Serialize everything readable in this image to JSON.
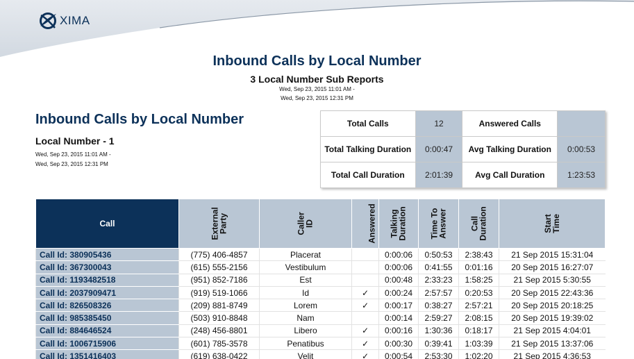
{
  "brand": {
    "name": "XIMA",
    "color": "#0c3159"
  },
  "report": {
    "title": "Inbound Calls by Local Number",
    "subtitle": "3 Local Number Sub Reports",
    "range_line1": "Wed, Sep 23, 2015 11:01 AM -",
    "range_line2": "Wed, Sep 23, 2015 12:31 PM"
  },
  "section": {
    "title": "Inbound Calls by Local Number",
    "name": "Local Number - 1",
    "range_line1": "Wed, Sep 23, 2015 11:01 AM -",
    "range_line2": "Wed, Sep 23, 2015 12:31 PM"
  },
  "summary": [
    {
      "label1": "Total Calls",
      "value1": "12",
      "label2": "Answered Calls",
      "value2": ""
    },
    {
      "label1": "Total Talking Duration",
      "value1": "0:00:47",
      "label2": "Avg Talking Duration",
      "value2": "0:00:53"
    },
    {
      "label1": "Total Call Duration",
      "value1": "2:01:39",
      "label2": "Avg Call Duration",
      "value2": "1:23:53"
    }
  ],
  "table": {
    "headers": {
      "call": "Call",
      "external_party": "External\nParty",
      "caller_id": "Caller\nID",
      "answered": "Answered",
      "talking_duration": "Talking\nDuration",
      "time_to_answer": "Time To\nAnswer",
      "call_duration": "Call\nDuration",
      "start_time": "Start\nTime"
    },
    "check_glyph": "✓",
    "rows": [
      {
        "call": "Call Id: 380905436",
        "external": "(775) 406-4857",
        "caller": "Placerat",
        "answered": "",
        "talking": "0:00:06",
        "tta": "0:50:53",
        "duration": "2:38:43",
        "start": "21 Sep 2015 15:31:04"
      },
      {
        "call": "Call Id: 367300043",
        "external": "(615) 555-2156",
        "caller": "Vestibulum",
        "answered": "",
        "talking": "0:00:06",
        "tta": "0:41:55",
        "duration": "0:01:16",
        "start": "20 Sep 2015 16:27:07"
      },
      {
        "call": "Call Id: 1193482518",
        "external": "(951) 852-7186",
        "caller": "Est",
        "answered": "",
        "talking": "0:00:48",
        "tta": "2:33:23",
        "duration": "1:58:25",
        "start": "21 Sep 2015 5:30:55"
      },
      {
        "call": "Call Id: 2037909471",
        "external": "(919) 519-1066",
        "caller": "Id",
        "answered": "✓",
        "talking": "0:00:24",
        "tta": "2:57:57",
        "duration": "0:20:53",
        "start": "20 Sep 2015 22:43:36"
      },
      {
        "call": "Call Id: 826508326",
        "external": "(209) 881-8749",
        "caller": "Lorem",
        "answered": "✓",
        "talking": "0:00:17",
        "tta": "0:38:27",
        "duration": "2:57:21",
        "start": "20 Sep 2015 20:18:25"
      },
      {
        "call": "Call Id: 985385450",
        "external": "(503) 910-8848",
        "caller": "Nam",
        "answered": "",
        "talking": "0:00:14",
        "tta": "2:59:27",
        "duration": "2:08:15",
        "start": "20 Sep 2015 19:39:02"
      },
      {
        "call": "Call Id: 884646524",
        "external": "(248) 456-8801",
        "caller": "Libero",
        "answered": "✓",
        "talking": "0:00:16",
        "tta": "1:30:36",
        "duration": "0:18:17",
        "start": "21 Sep 2015 4:04:01"
      },
      {
        "call": "Call Id: 1006715906",
        "external": "(601) 785-3578",
        "caller": "Penatibus",
        "answered": "✓",
        "talking": "0:00:30",
        "tta": "0:39:41",
        "duration": "1:03:39",
        "start": "21 Sep 2015 13:37:06"
      },
      {
        "call": "Call Id: 1351416403",
        "external": "(619) 638-0422",
        "caller": "Velit",
        "answered": "✓",
        "talking": "0:00:54",
        "tta": "2:53:30",
        "duration": "1:02:20",
        "start": "21 Sep 2015 4:36:53"
      }
    ]
  }
}
